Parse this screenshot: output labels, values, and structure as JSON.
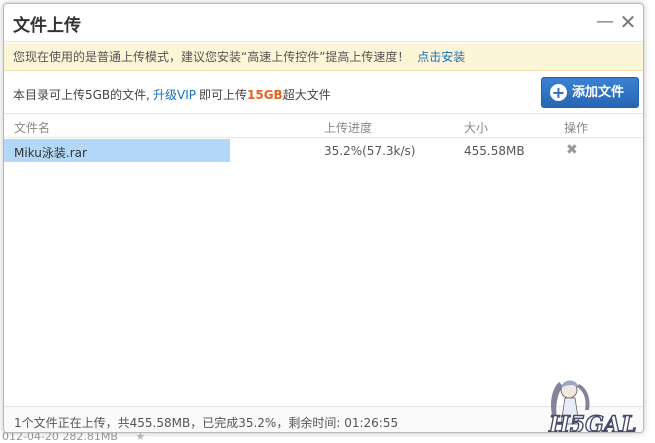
{
  "dialog": {
    "title": "文件上传"
  },
  "notice": {
    "text": "您现在使用的是普通上传模式，建议您安装“高速上传控件”提高上传速度！",
    "link": "点击安装"
  },
  "info": {
    "prefix": "本目录可上传5GB的文件,",
    "vip_link": "升级VIP",
    "middle": "即可上传",
    "capacity": "15GB",
    "suffix": "超大文件",
    "add_button": "添加文件"
  },
  "table": {
    "columns": [
      "文件名",
      "上传进度",
      "大小",
      "操作"
    ],
    "rows": [
      {
        "name": "Miku泳装.rar",
        "progress_text": "35.2%(57.3k/s)",
        "progress": 0.352,
        "size": "455.58MB"
      }
    ]
  },
  "footer": {
    "status": "1个文件正在上传，共455.58MB，已完成35.2%，剩余时间: 01:26:55"
  },
  "watermark": {
    "text": "H5GAL"
  },
  "background": {
    "bottom_text": "012-04-20    282.81MB"
  },
  "colors": {
    "accent": "#2a6cb8",
    "link": "#1a6fb5",
    "capacity": "#e8601f",
    "notice_bg": "#fdf5d8",
    "progress": "#b3d8f7"
  }
}
